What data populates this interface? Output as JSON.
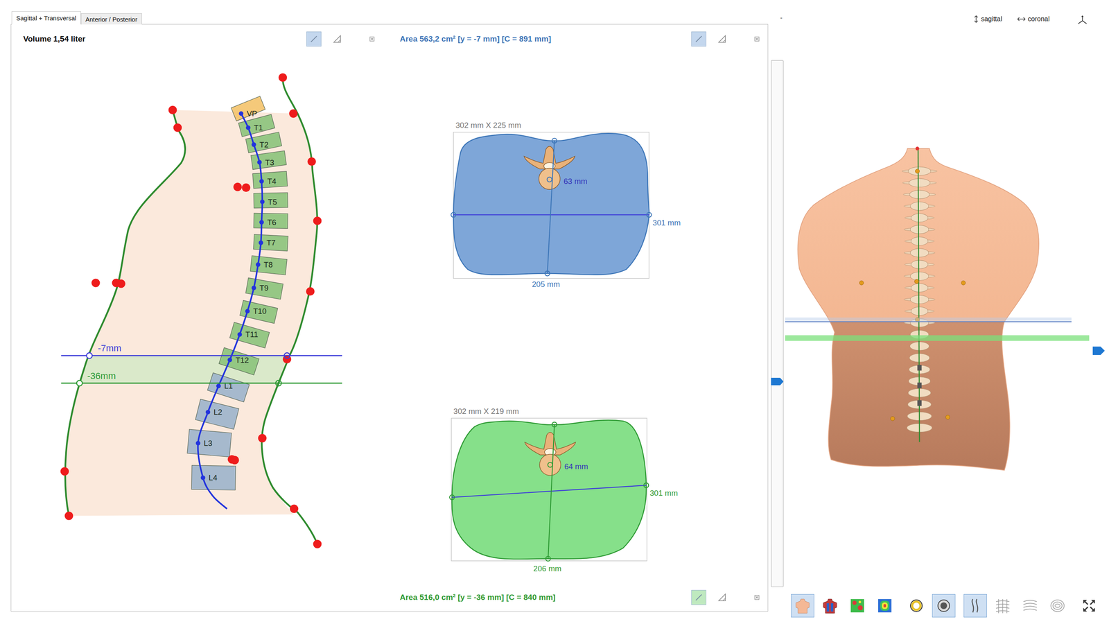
{
  "tabs": [
    {
      "label": "Sagittal + Transversal",
      "selected": true
    },
    {
      "label": "Anterior / Posterior",
      "selected": false
    }
  ],
  "sagittal_view": {
    "title": "Volume 1,54 liter",
    "tools": [
      {
        "selected": true
      },
      {
        "selected": false
      }
    ],
    "vertebrae": [
      {
        "label": "VP",
        "color": "#f5c46c"
      },
      {
        "label": "T1",
        "color": "#8cc47c"
      },
      {
        "label": "T2",
        "color": "#8cc47c"
      },
      {
        "label": "T3",
        "color": "#8cc47c"
      },
      {
        "label": "T4",
        "color": "#8cc47c"
      },
      {
        "label": "T5",
        "color": "#8cc47c"
      },
      {
        "label": "T6",
        "color": "#8cc47c"
      },
      {
        "label": "T7",
        "color": "#8cc47c"
      },
      {
        "label": "T8",
        "color": "#8cc47c"
      },
      {
        "label": "T9",
        "color": "#8cc47c"
      },
      {
        "label": "T10",
        "color": "#8cc47c"
      },
      {
        "label": "T11",
        "color": "#8cc47c"
      },
      {
        "label": "T12",
        "color": "#8cc47c"
      },
      {
        "label": "L1",
        "color": "#9db4cc"
      },
      {
        "label": "L2",
        "color": "#9db4cc"
      },
      {
        "label": "L3",
        "color": "#9db4cc"
      },
      {
        "label": "L4",
        "color": "#9db4cc"
      }
    ],
    "cuts": [
      {
        "label": "-7mm",
        "color": "#3d3dd8"
      },
      {
        "label": "-36mm",
        "color": "#2e9a34"
      }
    ]
  },
  "transversal_view": {
    "sections": [
      {
        "title": "Area 563,2 cm² [y = -7 mm] [C = 891 mm]",
        "tools": [
          {
            "selected": true
          },
          {
            "selected": false
          }
        ],
        "size": "302 mm X 225 mm",
        "depth": "63 mm",
        "width": "301 mm",
        "height": "205 mm",
        "color": "#7ea6d8",
        "accent": "#3d76b8"
      },
      {
        "title": "Area 516,0 cm² [y = -36 mm] [C = 840 mm]",
        "tools": [
          {
            "selected": true
          },
          {
            "selected": false
          }
        ],
        "size": "302 mm X 219 mm",
        "depth": "64 mm",
        "width": "301 mm",
        "height": "206 mm",
        "color": "#86e08a",
        "accent": "#2e9a34"
      }
    ]
  },
  "model_view": {
    "minimize": "-",
    "views": [
      {
        "label": "sagittal",
        "selected": false
      },
      {
        "label": "coronal",
        "selected": false
      }
    ],
    "slider": {
      "level": 0.39
    },
    "toolbar": [
      [
        {
          "selected": true
        },
        {
          "selected": false
        },
        {
          "selected": false
        },
        {
          "selected": false
        }
      ],
      [
        {
          "selected": false
        },
        {
          "selected": true
        }
      ],
      [
        {
          "selected": true
        },
        {
          "selected": false
        },
        {
          "selected": false
        },
        {
          "selected": false
        }
      ],
      [
        {
          "selected": false
        }
      ]
    ]
  }
}
